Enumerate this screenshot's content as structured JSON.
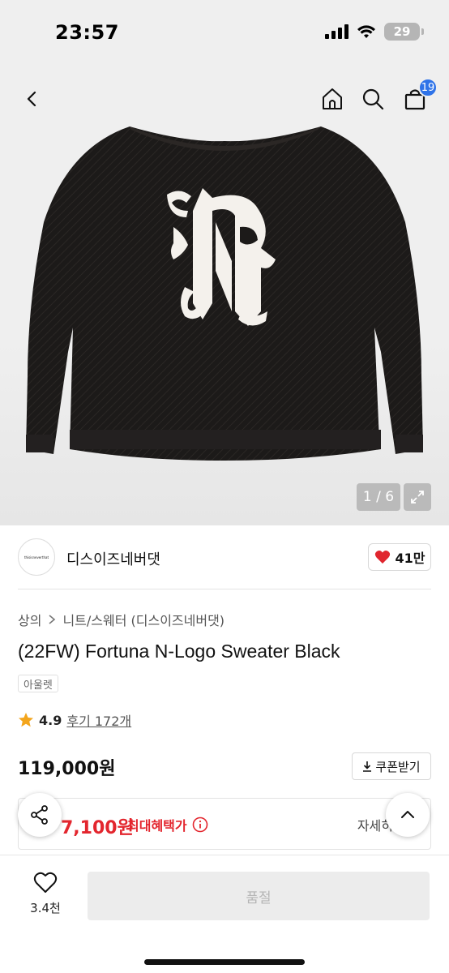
{
  "status_bar": {
    "time": "23:57",
    "battery": "29"
  },
  "nav": {
    "cart_count": "19"
  },
  "gallery": {
    "counter": "1 / 6"
  },
  "brand": {
    "name": "디스이즈네버댓",
    "logo_text": "thisisneverthat",
    "likes": "41만"
  },
  "breadcrumb": {
    "category": "상의",
    "subcategory": "니트/스웨터 (디스이즈네버댓)"
  },
  "product": {
    "title": "(22FW) Fortuna N-Logo Sweater Black",
    "tag": "아울렛",
    "rating": "4.9",
    "reviews": "후기 172개",
    "price": "119,000원"
  },
  "coupon": {
    "label": "쿠폰받기"
  },
  "benefit": {
    "price": "7,100원",
    "label": "최대혜택가",
    "detail": "자세히"
  },
  "bottom": {
    "wish_count": "3.4천",
    "buy_label": "품절"
  },
  "colors": {
    "accent_red": "#e3262e",
    "badge_blue": "#2f73e8",
    "heart": "#e0262e"
  }
}
